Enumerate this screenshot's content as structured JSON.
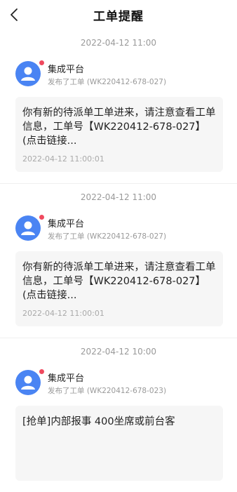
{
  "header": {
    "title": "工单提醒"
  },
  "messages": [
    {
      "time": "2022-04-12 11:00",
      "sender": "集成平台",
      "subtitle": "发布了工单 (WK220412-678-027)",
      "content": "你有新的待派单工单进来，请注意查看工单信息，工单号【WK220412-678-027】(点击链接...",
      "card_time": "2022-04-12 11:00:01"
    },
    {
      "time": "2022-04-12 11:00",
      "sender": "集成平台",
      "subtitle": "发布了工单 (WK220412-678-027)",
      "content": "你有新的待派单工单进来，请注意查看工单信息，工单号【WK220412-678-027】(点击链接...",
      "card_time": "2022-04-12 11:00:01"
    },
    {
      "time": "2022-04-12 10:00",
      "sender": "集成平台",
      "subtitle": "发布了工单 (WK220412-678-023)",
      "content": "[抢单]内部报事 400坐席或前台客",
      "card_time": ""
    }
  ]
}
